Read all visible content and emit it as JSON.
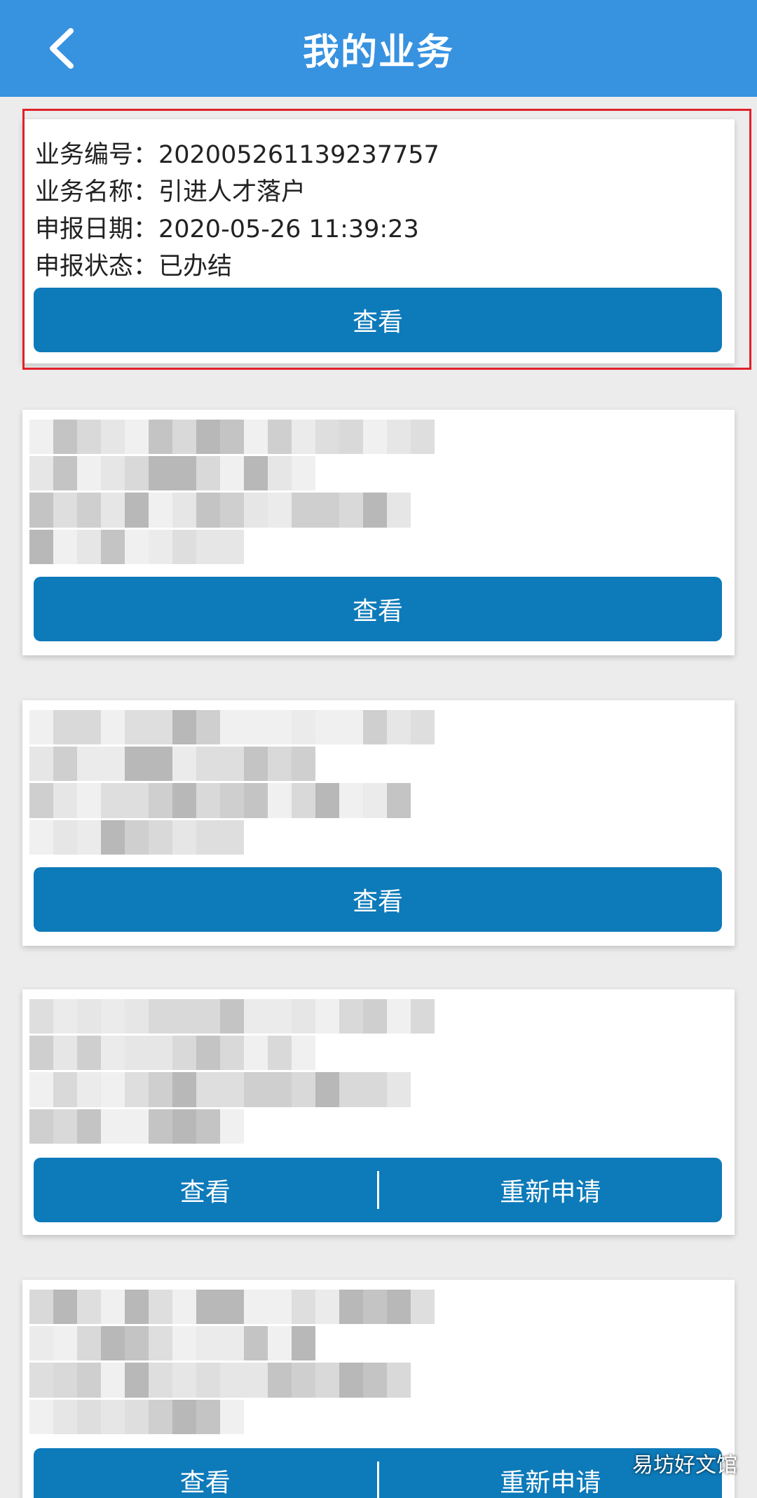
{
  "header": {
    "title": "我的业务",
    "back_icon": "chevron-left-icon",
    "background_color": "#3792e0"
  },
  "first_item": {
    "fields": [
      {
        "label": "业务编号：",
        "value": "202005261139237757"
      },
      {
        "label": "业务名称：",
        "value": "引进人才落户"
      },
      {
        "label": "申报日期：",
        "value": "2020-05-26 11:39:23"
      },
      {
        "label": "申报状态：",
        "value": "已办结"
      }
    ],
    "view_label": "查看"
  },
  "items": [
    {
      "view_label": "查看"
    },
    {
      "view_label": "查看"
    },
    {
      "view_label": "查看",
      "reapply_label": "重新申请"
    },
    {
      "view_label": "查看",
      "reapply_label": "重新申请"
    }
  ],
  "button_color": "#0d7ab9",
  "highlight_color": "#e0212a",
  "watermark": "易坊好文馆"
}
